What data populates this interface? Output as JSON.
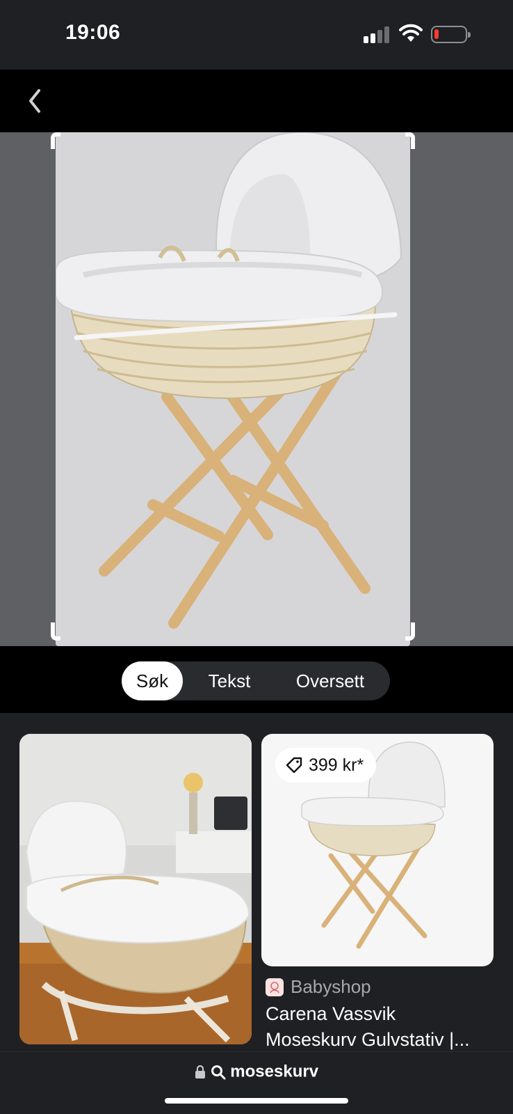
{
  "status": {
    "time": "19:06"
  },
  "modes": {
    "search": "Søk",
    "text": "Tekst",
    "translate": "Oversett",
    "active": "search"
  },
  "results": [
    {
      "image": "bassinet-on-rocking-stand-photo"
    },
    {
      "image": "bassinet-on-folding-stand-product",
      "price": "399 kr*",
      "source": "Babyshop",
      "title": "Carena Vassvik\nMoseskurv Gulvstativ |..."
    }
  ],
  "address_bar": {
    "query": "moseskurv"
  },
  "icons": {
    "back": "chevron-left-icon",
    "lock": "lock-icon",
    "search": "magnifier-icon",
    "tag": "price-tag-icon"
  },
  "colors": {
    "background": "#1f2023",
    "nav": "#000000",
    "battery_low": "#ff3b30"
  }
}
